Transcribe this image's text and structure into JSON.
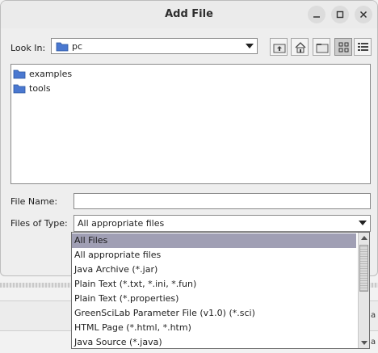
{
  "window": {
    "title": "Add File"
  },
  "look_in": {
    "label": "Look In:",
    "value": "pc"
  },
  "files": [
    {
      "name": "examples",
      "icon": "folder-icon"
    },
    {
      "name": "tools",
      "icon": "folder-icon"
    }
  ],
  "file_name": {
    "label": "File Name:",
    "value": ""
  },
  "files_of_type": {
    "label": "Files of Type:",
    "value": "All appropriate files",
    "options": [
      "All Files",
      "All appropriate files",
      "Java Archive (*.jar)",
      "Plain Text (*.txt, *.ini, *.fun)",
      "Plain Text (*.properties)",
      "GreenSciLab Parameter File (v1.0) (*.sci)",
      "HTML Page (*.html, *.htm)",
      "Java Source (*.java)"
    ],
    "highlighted_option": "All Files"
  },
  "background_fragments": {
    "a": "a",
    "b": "a"
  },
  "colors": {
    "selection": "#a09fb4",
    "folder": "#3d6bc4"
  }
}
